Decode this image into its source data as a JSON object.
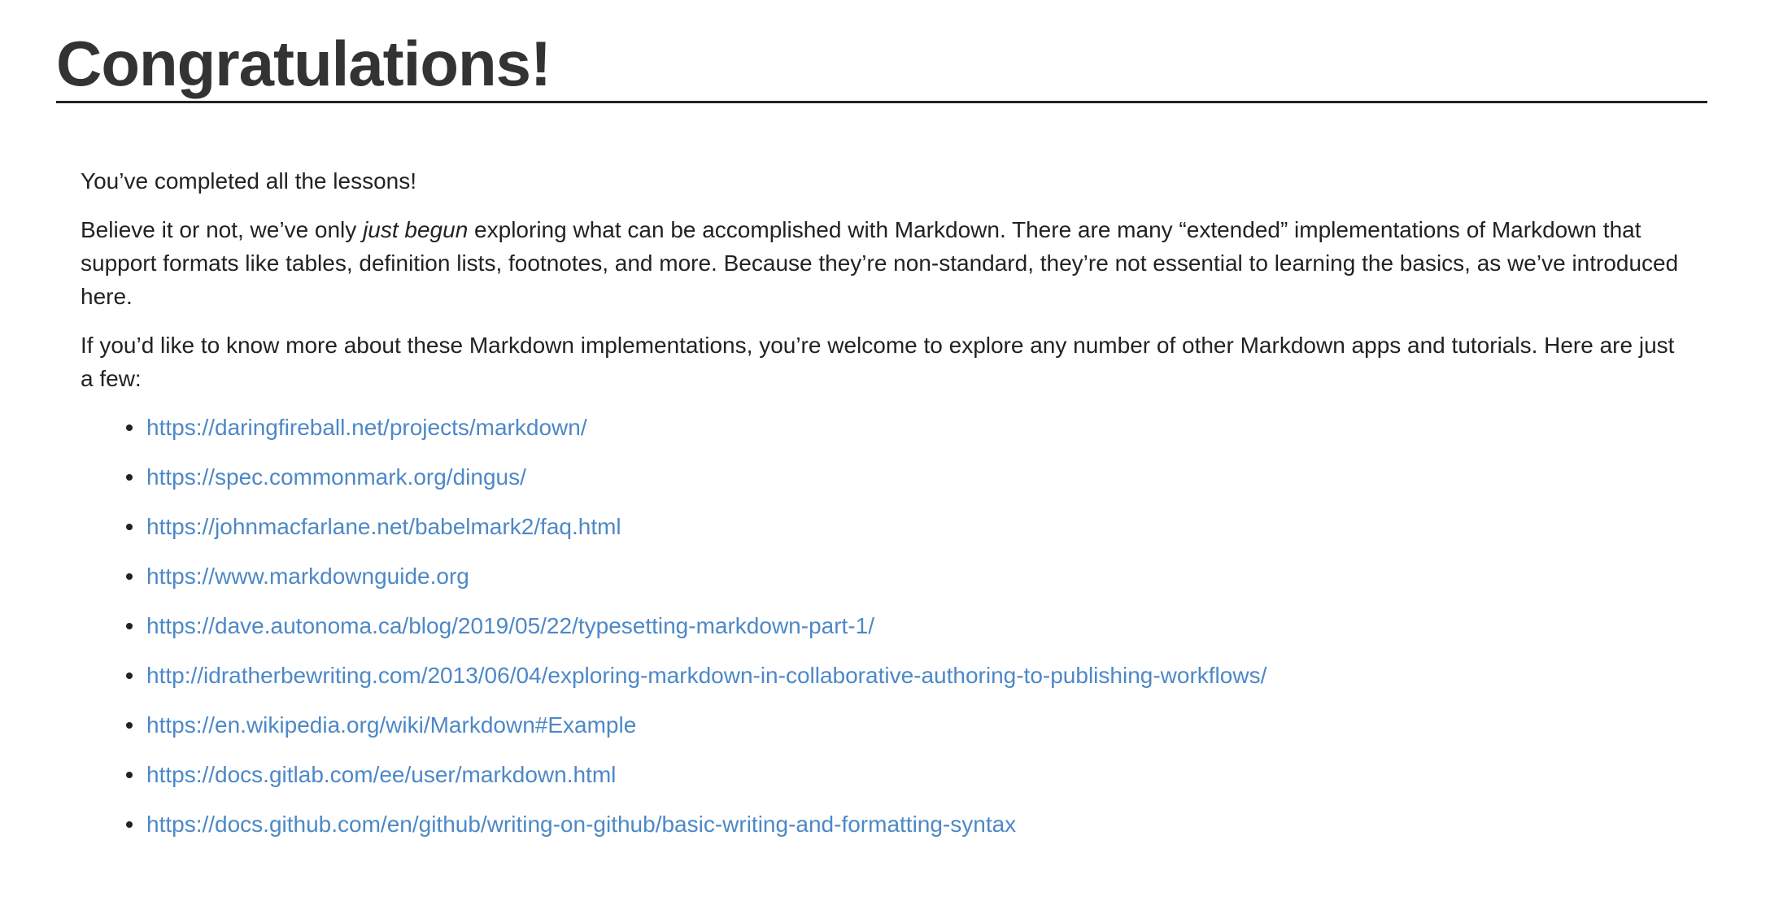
{
  "page": {
    "title": "Congratulations!",
    "intro": "You’ve completed all the lessons!",
    "paragraph2": {
      "before": "Believe it or not, we’ve only ",
      "emphasis": "just begun",
      "after": " exploring what can be accomplished with Markdown. There are many “extended” implementations of Markdown that support formats like tables, definition lists, footnotes, and more. Because they’re non-standard, they’re not essential to learning the basics, as we’ve introduced here."
    },
    "paragraph3": "If you’d like to know more about these Markdown implementations, you’re welcome to explore any number of other Markdown apps and tutorials. Here are just a few:",
    "links": [
      "https://daringfireball.net/projects/markdown/",
      "https://spec.commonmark.org/dingus/",
      "https://johnmacfarlane.net/babelmark2/faq.html",
      "https://www.markdownguide.org",
      "https://dave.autonoma.ca/blog/2019/05/22/typesetting-markdown-part-1/",
      "http://idratherbewriting.com/2013/06/04/exploring-markdown-in-collaborative-authoring-to-publishing-workflows/",
      "https://en.wikipedia.org/wiki/Markdown#Example",
      "https://docs.gitlab.com/ee/user/markdown.html",
      "https://docs.github.com/en/github/writing-on-github/basic-writing-and-formatting-syntax"
    ]
  },
  "colors": {
    "link": "#4d88c6",
    "text": "#222222",
    "title": "#333333"
  }
}
